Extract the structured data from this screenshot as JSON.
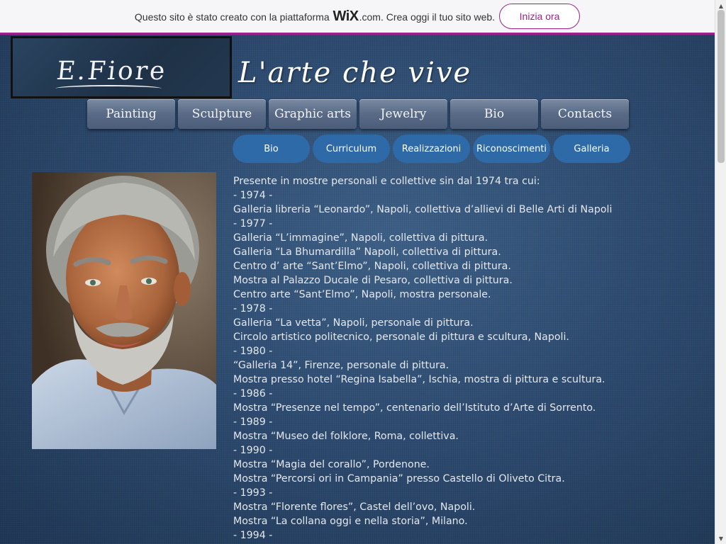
{
  "wix_banner": {
    "text_before": "Questo sito è stato creato con la piattaforma",
    "logo_wix": "WiX",
    "logo_suffix": ".com.",
    "text_after": "Crea oggi il tuo sito web.",
    "cta_label": "Inizia ora"
  },
  "header": {
    "logo_text": "E.Fiore",
    "site_title": "L'arte che vive"
  },
  "main_nav": [
    "Painting",
    "Sculpture",
    "Graphic arts",
    "Jewelry",
    "Bio",
    "Contacts"
  ],
  "sub_nav": [
    "Bio",
    "Curriculum",
    "Realizzazioni",
    "Riconoscimenti",
    "Galleria"
  ],
  "bio_lines": [
    "Presente in mostre personali e collettive sin dal 1974 tra cui:",
    "- 1974 -",
    "Galleria libreria “Leonardo”, Napoli, collettiva d’allievi di Belle Arti di Napoli",
    "- 1977 -",
    "Galleria “L’immagine”, Napoli, collettiva di pittura.",
    "Galleria “La Bhumardilla” Napoli, collettiva di pittura.",
    "Centro d’ arte “Sant’Elmo”, Napoli, collettiva di pittura.",
    "Mostra al Palazzo Ducale di Pesaro, collettiva di pittura.",
    "Centro arte “Sant’Elmo”, Napoli, mostra personale.",
    "- 1978 -",
    "Galleria “La vetta”, Napoli, personale di pittura.",
    "Circolo artistico politecnico, personale di pittura e scultura, Napoli.",
    "- 1980 -",
    "“Galleria 14”, Firenze, personale di pittura.",
    "Mostra presso hotel “Regina Isabella”, Ischia, mostra di pittura e scultura.",
    "- 1986 -",
    "Mostra “Presenze nel tempo”, centenario dell’Istituto d’Arte di Sorrento.",
    "- 1989 -",
    "Mostra “Museo del folklore, Roma, collettiva.",
    "- 1990 -",
    "Mostra “Magia del corallo”, Pordenone.",
    "Mostra “Percorsi ori in Campania” presso Castello di Oliveto Citra.",
    "- 1993 -",
    "Mostra “Florente flores”, Castel dell’ovo, Napoli.",
    "Mostra “La collana oggi e nella storia”, Milano.",
    "- 1994 -"
  ],
  "colors": {
    "wix_accent": "#a0208e",
    "sub_nav_bg": "#2f6aa8",
    "page_bg": "#2d4b70"
  }
}
